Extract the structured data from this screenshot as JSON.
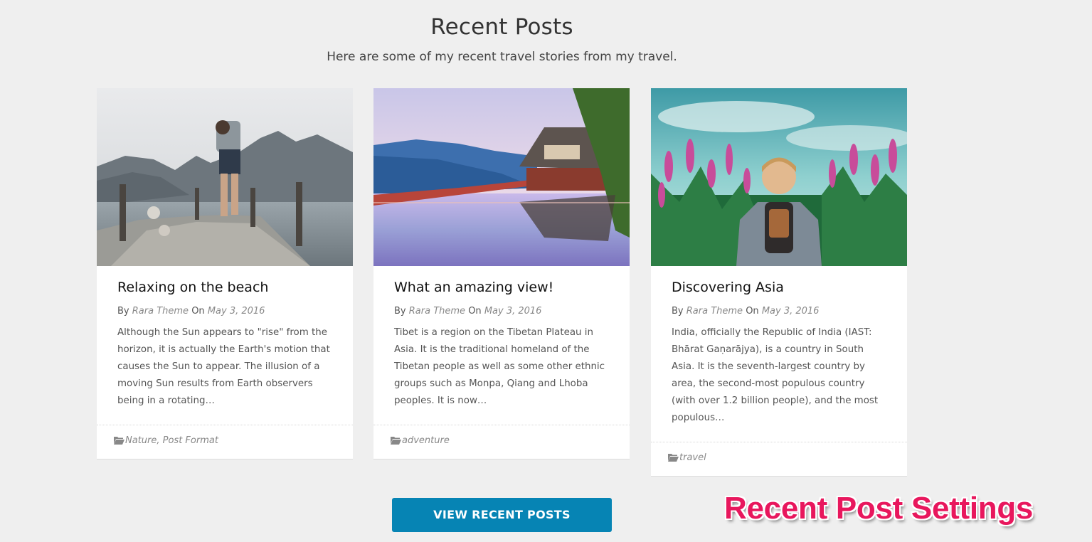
{
  "section": {
    "title": "Recent Posts",
    "subtitle": "Here are some of my recent travel stories from my travel."
  },
  "posts": [
    {
      "image_desc": "beach-pier-photo",
      "title": "Relaxing on the beach",
      "by_label": "By",
      "author": "Rara Theme",
      "on_label": "On",
      "date": "May 3, 2016",
      "excerpt": "Although the Sun appears to \"rise\" from the horizon, it is actually the Earth's motion that causes the Sun to appear. The illusion of a moving Sun results from Earth observers being in a rotating…",
      "categories": "Nature, Post Format"
    },
    {
      "image_desc": "lake-house-photo",
      "title": "What an amazing view!",
      "by_label": "By",
      "author": "Rara Theme",
      "on_label": "On",
      "date": "May 3, 2016",
      "excerpt": "Tibet is a region on the Tibetan Plateau in Asia. It is the traditional homeland of the Tibetan people as well as some other ethnic groups such as Monpa, Qiang and Lhoba peoples. It is now…",
      "categories": "adventure"
    },
    {
      "image_desc": "flower-field-backpacker-photo",
      "title": "Discovering Asia",
      "by_label": "By",
      "author": "Rara Theme",
      "on_label": "On",
      "date": "May 3, 2016",
      "excerpt": "India, officially the Republic of India (IAST: Bhārat Gaṇarājya), is a country in South Asia. It is the seventh-largest country by area, the second-most populous country (with over 1.2 billion people), and the most populous…",
      "categories": "travel"
    }
  ],
  "button": {
    "label": "VIEW RECENT POSTS"
  },
  "overlay": {
    "label": "Recent Post Settings"
  },
  "colors": {
    "background": "#efefef",
    "button": "#0684b4",
    "overlay_text": "#e8175d",
    "meta_link": "#888888"
  }
}
